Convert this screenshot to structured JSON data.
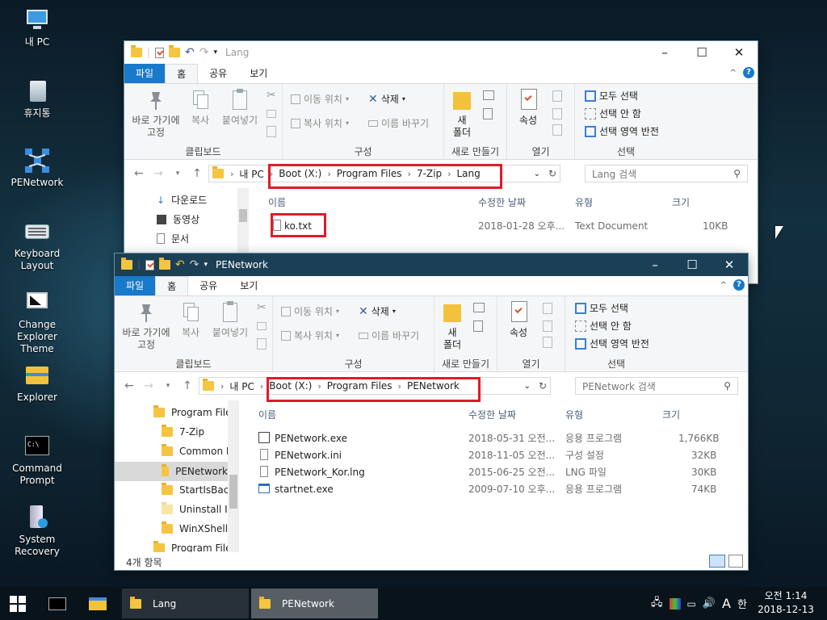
{
  "desktop": {
    "icons": [
      {
        "label": "내 PC",
        "icon": "monitor-icon"
      },
      {
        "label": "휴지통",
        "icon": "recycle-bin-icon"
      },
      {
        "label": "PENetwork",
        "icon": "network-icon"
      },
      {
        "label": "Keyboard Layout",
        "icon": "keyboard-icon"
      },
      {
        "label": "Change Explorer Theme",
        "icon": "theme-icon"
      },
      {
        "label": "Explorer",
        "icon": "explorer-icon"
      },
      {
        "label": "Command Prompt",
        "icon": "cmd-icon"
      },
      {
        "label": "System Recovery",
        "icon": "recovery-icon"
      }
    ]
  },
  "win_lang": {
    "title": "Lang",
    "tabs": [
      "파일",
      "홈",
      "공유",
      "보기"
    ],
    "ribbon": {
      "pin_label1": "바로 가기에",
      "pin_label2": "고정",
      "copy_label": "복사",
      "paste_label": "붙여넣기",
      "clipboard_group": "클립보드",
      "move_to": "이동 위치",
      "copy_to": "복사 위치",
      "delete": "삭제",
      "rename": "이름 바꾸기",
      "organize_group": "구성",
      "new_folder1": "새",
      "new_folder2": "폴더",
      "new_group": "새로 만들기",
      "properties": "속성",
      "open_group": "열기",
      "select_all": "모두 선택",
      "select_none": "선택 안 함",
      "invert_selection": "선택 영역 반전",
      "select_group": "선택"
    },
    "breadcrumb": [
      "내 PC",
      "Boot (X:)",
      "Program Files",
      "7-Zip",
      "Lang"
    ],
    "search_placeholder": "Lang 검색",
    "nav_items": [
      "다운로드",
      "동영상",
      "문서"
    ],
    "columns": [
      "이름",
      "수정한 날짜",
      "유형",
      "크기"
    ],
    "files": [
      {
        "name": "ko.txt",
        "date": "2018-01-28 오후...",
        "type": "Text Document",
        "size": "10KB"
      }
    ]
  },
  "win_pe": {
    "title": "PENetwork",
    "tabs": [
      "파일",
      "홈",
      "공유",
      "보기"
    ],
    "breadcrumb": [
      "내 PC",
      "Boot (X:)",
      "Program Files",
      "PENetwork"
    ],
    "search_placeholder": "PENetwork 검색",
    "nav_items": [
      "Program Files",
      "7-Zip",
      "Common F",
      "PENetwork",
      "StartIsBack",
      "Uninstall Int",
      "WinXShell",
      "Program Files"
    ],
    "columns": [
      "이름",
      "수정한 날짜",
      "유형",
      "크기"
    ],
    "files": [
      {
        "name": "PENetwork.exe",
        "date": "2018-05-31 오전...",
        "type": "응용 프로그램",
        "size": "1,766KB"
      },
      {
        "name": "PENetwork.ini",
        "date": "2018-11-05 오전...",
        "type": "구성 설정",
        "size": "32KB"
      },
      {
        "name": "PENetwork_Kor.lng",
        "date": "2015-06-25 오전...",
        "type": "LNG 파일",
        "size": "30KB"
      },
      {
        "name": "startnet.exe",
        "date": "2009-07-10 오후...",
        "type": "응용 프로그램",
        "size": "74KB"
      }
    ],
    "status": "4개 항목"
  },
  "taskbar": {
    "lang_task": "Lang",
    "pe_task": "PENetwork",
    "ime_a": "A",
    "ime_han": "한",
    "time": "오전 1:14",
    "date": "2018-12-13"
  }
}
